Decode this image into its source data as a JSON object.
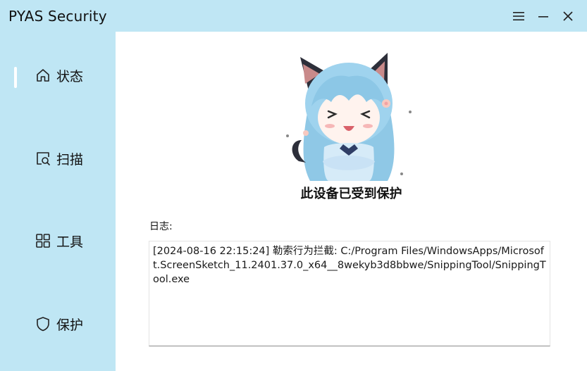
{
  "window": {
    "title": "PYAS Security",
    "controls": {
      "menu_icon": "hamburger-icon",
      "minimize_icon": "minimize-icon",
      "close_icon": "close-icon"
    }
  },
  "sidebar": {
    "items": [
      {
        "label": "状态",
        "icon": "home-icon",
        "active": true
      },
      {
        "label": "扫描",
        "icon": "scan-icon",
        "active": false
      },
      {
        "label": "工具",
        "icon": "grid-icon",
        "active": false
      },
      {
        "label": "保护",
        "icon": "shield-icon",
        "active": false
      }
    ]
  },
  "main": {
    "status_text": "此设备已受到保护",
    "log_label": "日志:",
    "log_text": "[2024-08-16 22:15:24] 勒索行为拦截: C:/Program Files/WindowsApps/Microsoft.ScreenSketch_11.2401.37.0_x64__8wekyb3d8bbwe/SnippingTool/SnippingTool.exe"
  },
  "colors": {
    "accent": "#bfe6f4",
    "background": "#ffffff"
  }
}
